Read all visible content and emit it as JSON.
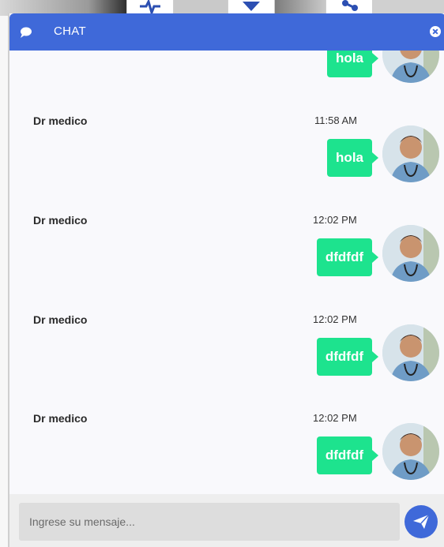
{
  "header": {
    "title": "CHAT",
    "chat_icon": "chat-bubble-icon",
    "close_icon": "close-icon"
  },
  "messages": [
    {
      "sender": "",
      "time": "",
      "text": "hola"
    },
    {
      "sender": "Dr medico",
      "time": "11:58 AM",
      "text": "hola"
    },
    {
      "sender": "Dr medico",
      "time": "12:02 PM",
      "text": "dfdfdf"
    },
    {
      "sender": "Dr medico",
      "time": "12:02 PM",
      "text": "dfdfdf"
    },
    {
      "sender": "Dr medico",
      "time": "12:02 PM",
      "text": "dfdfdf"
    }
  ],
  "composer": {
    "placeholder": "Ingrese su mensaje...",
    "value": "",
    "send_icon": "paper-plane-icon"
  },
  "colors": {
    "header": "#3f69d9",
    "bubble": "#1de38e",
    "send_button": "#3f69d9"
  }
}
